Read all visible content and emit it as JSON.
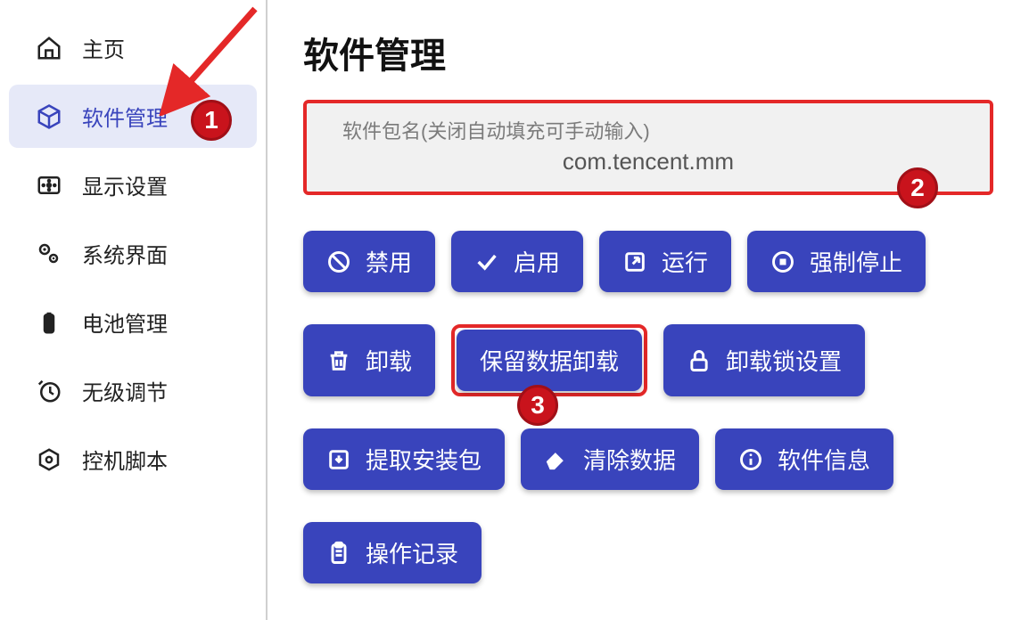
{
  "sidebar": {
    "items": [
      {
        "label": "主页",
        "icon": "home-icon",
        "active": false
      },
      {
        "label": "软件管理",
        "icon": "package-icon",
        "active": true
      },
      {
        "label": "显示设置",
        "icon": "display-icon",
        "active": false
      },
      {
        "label": "系统界面",
        "icon": "gears-icon",
        "active": false
      },
      {
        "label": "电池管理",
        "icon": "battery-icon",
        "active": false
      },
      {
        "label": "无级调节",
        "icon": "clock-icon",
        "active": false
      },
      {
        "label": "控机脚本",
        "icon": "hexagon-icon",
        "active": false
      }
    ]
  },
  "main": {
    "title": "软件管理",
    "package_input": {
      "label": "软件包名(关闭自动填充可手动输入)",
      "value": "com.tencent.mm"
    },
    "buttons": {
      "disable": "禁用",
      "enable": "启用",
      "run": "运行",
      "force_stop": "强制停止",
      "uninstall": "卸载",
      "keep_data_uninstall": "保留数据卸载",
      "uninstall_lock": "卸载锁设置",
      "extract_apk": "提取安装包",
      "clear_data": "清除数据",
      "app_info": "软件信息",
      "op_log": "操作记录"
    }
  },
  "annotations": {
    "badge1": "1",
    "badge2": "2",
    "badge3": "3"
  },
  "colors": {
    "accent": "#3944bc",
    "annotation_red": "#e42828",
    "badge_red": "#c9131c"
  }
}
